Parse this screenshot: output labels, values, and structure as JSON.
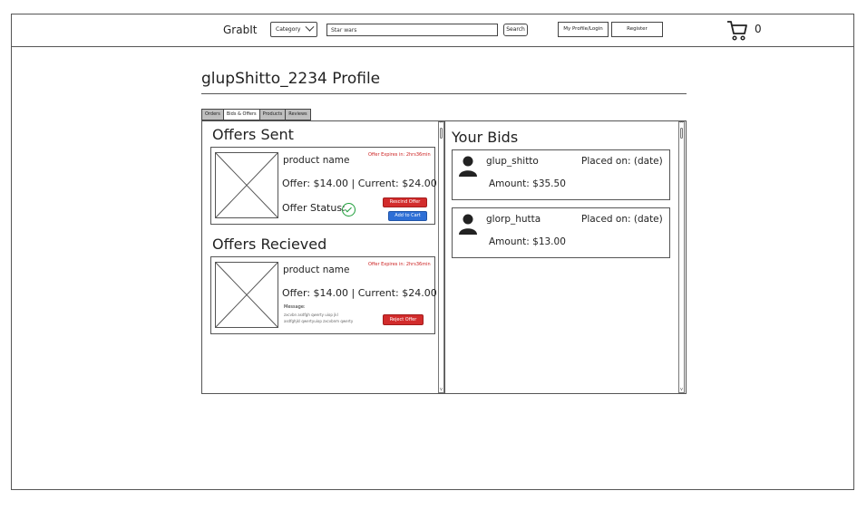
{
  "header": {
    "brand": "GrabIt",
    "category_label": "Category",
    "search_value": "Star wars",
    "search_button": "Search",
    "profile_button": "My Profile/Login",
    "register_button": "Register",
    "cart_count": "0"
  },
  "profile": {
    "title": "glupShitto_2234 Profile"
  },
  "tabs": [
    "Orders",
    "Bids & Offers",
    "Products",
    "Reviews"
  ],
  "offers_sent": {
    "title": "Offers Sent",
    "item": {
      "product_name": "product name",
      "expires": "Offer Expires in: 2hrs36min",
      "offer_line": "Offer: $14.00 | Current: $24.00",
      "status_label": "Offer Status:",
      "rescind_button": "Rescind Offer",
      "add_to_cart_button": "Add to Cart"
    }
  },
  "offers_received": {
    "title": "Offers Recieved",
    "item": {
      "product_name": "product name",
      "expires": "Offer Expires in: 2hrs36min",
      "offer_line": "Offer: $14.00 | Current: $24.00",
      "message_label": "Message:",
      "message_line1": "zxcvbn asdfgh qwerty uiop jkl",
      "message_line2": "asdfghjkl qwertyuiop zxcvbnm qwerty",
      "reject_button": "Reject Offer"
    }
  },
  "your_bids": {
    "title": "Your Bids",
    "bids": [
      {
        "user": "glup_shitto",
        "placed": "Placed on: (date)",
        "amount": "Amount: $35.50"
      },
      {
        "user": "glorp_hutta",
        "placed": "Placed on: (date)",
        "amount": "Amount: $13.00"
      }
    ]
  },
  "colors": {
    "reject_red": "#d22c2c",
    "cart_blue": "#2e6fd6",
    "status_green": "#1e9e3a",
    "expires_red": "#cc2222"
  }
}
